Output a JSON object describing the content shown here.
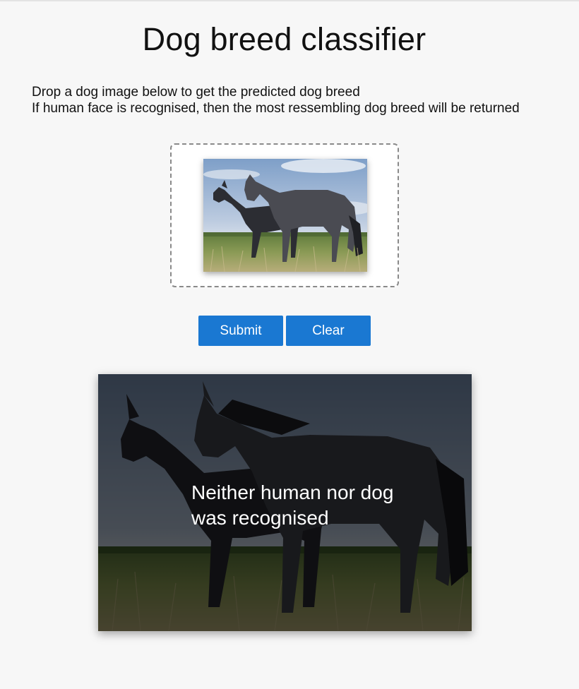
{
  "page": {
    "title": "Dog breed classifier"
  },
  "intro": {
    "line1": "Drop a dog image below to get the predicted dog breed",
    "line2": "If human face is recognised, then the most ressembling dog breed will be returned"
  },
  "dropzone": {
    "preview_image": "two-horses-photo"
  },
  "actions": {
    "submit_label": "Submit",
    "clear_label": "Clear"
  },
  "result": {
    "image": "two-horses-photo",
    "message": "Neither human nor dog was recognised"
  },
  "colors": {
    "background": "#f7f7f7",
    "button": "#1a78d2",
    "button_text": "#ffffff",
    "dropzone_border": "#8a8a8a"
  }
}
